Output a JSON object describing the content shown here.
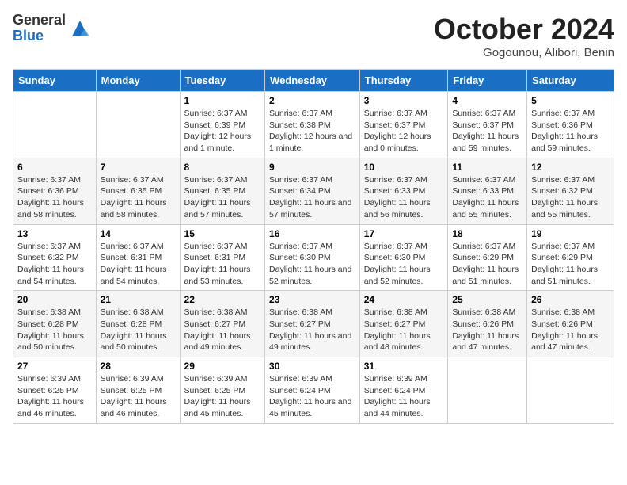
{
  "header": {
    "logo_general": "General",
    "logo_blue": "Blue",
    "month_title": "October 2024",
    "subtitle": "Gogounou, Alibori, Benin"
  },
  "columns": [
    "Sunday",
    "Monday",
    "Tuesday",
    "Wednesday",
    "Thursday",
    "Friday",
    "Saturday"
  ],
  "weeks": [
    [
      {
        "day": "",
        "info": ""
      },
      {
        "day": "",
        "info": ""
      },
      {
        "day": "1",
        "info": "Sunrise: 6:37 AM\nSunset: 6:39 PM\nDaylight: 12 hours and 1 minute."
      },
      {
        "day": "2",
        "info": "Sunrise: 6:37 AM\nSunset: 6:38 PM\nDaylight: 12 hours and 1 minute."
      },
      {
        "day": "3",
        "info": "Sunrise: 6:37 AM\nSunset: 6:37 PM\nDaylight: 12 hours and 0 minutes."
      },
      {
        "day": "4",
        "info": "Sunrise: 6:37 AM\nSunset: 6:37 PM\nDaylight: 11 hours and 59 minutes."
      },
      {
        "day": "5",
        "info": "Sunrise: 6:37 AM\nSunset: 6:36 PM\nDaylight: 11 hours and 59 minutes."
      }
    ],
    [
      {
        "day": "6",
        "info": "Sunrise: 6:37 AM\nSunset: 6:36 PM\nDaylight: 11 hours and 58 minutes."
      },
      {
        "day": "7",
        "info": "Sunrise: 6:37 AM\nSunset: 6:35 PM\nDaylight: 11 hours and 58 minutes."
      },
      {
        "day": "8",
        "info": "Sunrise: 6:37 AM\nSunset: 6:35 PM\nDaylight: 11 hours and 57 minutes."
      },
      {
        "day": "9",
        "info": "Sunrise: 6:37 AM\nSunset: 6:34 PM\nDaylight: 11 hours and 57 minutes."
      },
      {
        "day": "10",
        "info": "Sunrise: 6:37 AM\nSunset: 6:33 PM\nDaylight: 11 hours and 56 minutes."
      },
      {
        "day": "11",
        "info": "Sunrise: 6:37 AM\nSunset: 6:33 PM\nDaylight: 11 hours and 55 minutes."
      },
      {
        "day": "12",
        "info": "Sunrise: 6:37 AM\nSunset: 6:32 PM\nDaylight: 11 hours and 55 minutes."
      }
    ],
    [
      {
        "day": "13",
        "info": "Sunrise: 6:37 AM\nSunset: 6:32 PM\nDaylight: 11 hours and 54 minutes."
      },
      {
        "day": "14",
        "info": "Sunrise: 6:37 AM\nSunset: 6:31 PM\nDaylight: 11 hours and 54 minutes."
      },
      {
        "day": "15",
        "info": "Sunrise: 6:37 AM\nSunset: 6:31 PM\nDaylight: 11 hours and 53 minutes."
      },
      {
        "day": "16",
        "info": "Sunrise: 6:37 AM\nSunset: 6:30 PM\nDaylight: 11 hours and 52 minutes."
      },
      {
        "day": "17",
        "info": "Sunrise: 6:37 AM\nSunset: 6:30 PM\nDaylight: 11 hours and 52 minutes."
      },
      {
        "day": "18",
        "info": "Sunrise: 6:37 AM\nSunset: 6:29 PM\nDaylight: 11 hours and 51 minutes."
      },
      {
        "day": "19",
        "info": "Sunrise: 6:37 AM\nSunset: 6:29 PM\nDaylight: 11 hours and 51 minutes."
      }
    ],
    [
      {
        "day": "20",
        "info": "Sunrise: 6:38 AM\nSunset: 6:28 PM\nDaylight: 11 hours and 50 minutes."
      },
      {
        "day": "21",
        "info": "Sunrise: 6:38 AM\nSunset: 6:28 PM\nDaylight: 11 hours and 50 minutes."
      },
      {
        "day": "22",
        "info": "Sunrise: 6:38 AM\nSunset: 6:27 PM\nDaylight: 11 hours and 49 minutes."
      },
      {
        "day": "23",
        "info": "Sunrise: 6:38 AM\nSunset: 6:27 PM\nDaylight: 11 hours and 49 minutes."
      },
      {
        "day": "24",
        "info": "Sunrise: 6:38 AM\nSunset: 6:27 PM\nDaylight: 11 hours and 48 minutes."
      },
      {
        "day": "25",
        "info": "Sunrise: 6:38 AM\nSunset: 6:26 PM\nDaylight: 11 hours and 47 minutes."
      },
      {
        "day": "26",
        "info": "Sunrise: 6:38 AM\nSunset: 6:26 PM\nDaylight: 11 hours and 47 minutes."
      }
    ],
    [
      {
        "day": "27",
        "info": "Sunrise: 6:39 AM\nSunset: 6:25 PM\nDaylight: 11 hours and 46 minutes."
      },
      {
        "day": "28",
        "info": "Sunrise: 6:39 AM\nSunset: 6:25 PM\nDaylight: 11 hours and 46 minutes."
      },
      {
        "day": "29",
        "info": "Sunrise: 6:39 AM\nSunset: 6:25 PM\nDaylight: 11 hours and 45 minutes."
      },
      {
        "day": "30",
        "info": "Sunrise: 6:39 AM\nSunset: 6:24 PM\nDaylight: 11 hours and 45 minutes."
      },
      {
        "day": "31",
        "info": "Sunrise: 6:39 AM\nSunset: 6:24 PM\nDaylight: 11 hours and 44 minutes."
      },
      {
        "day": "",
        "info": ""
      },
      {
        "day": "",
        "info": ""
      }
    ]
  ]
}
